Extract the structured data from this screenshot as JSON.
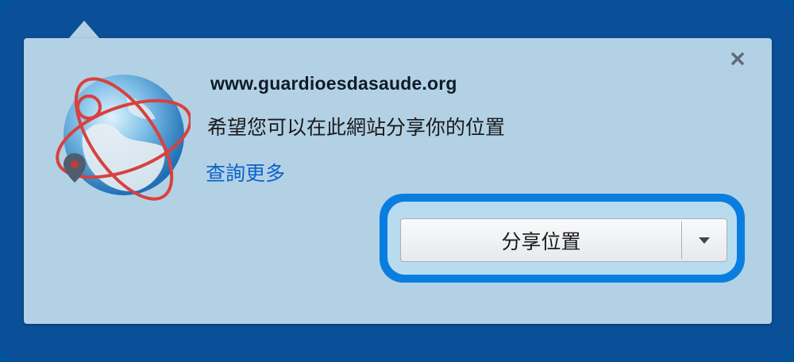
{
  "doorhanger": {
    "site": "www.guardioesdasaude.org",
    "message": "希望您可以在此網站分享你的位置",
    "learn_more": "查詢更多",
    "share_button_label": "分享位置",
    "icons": {
      "close": "close-icon",
      "globe": "geolocation-globe-icon",
      "pin": "location-pin-icon",
      "dropdown": "chevron-down-icon"
    }
  },
  "colors": {
    "background": "#0a4f97",
    "panel": "#b3d1e5",
    "link": "#0b63c9",
    "focus_ring": "#0a7ee0"
  }
}
